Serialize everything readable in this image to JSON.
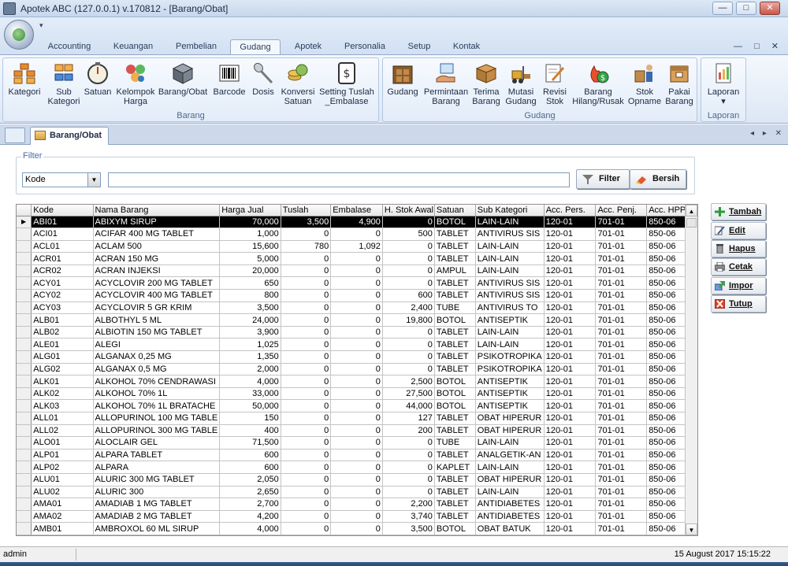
{
  "window": {
    "title": "Apotek ABC (127.0.0.1) v.170812 - [Barang/Obat]",
    "controls": [
      "—",
      "□",
      "✕"
    ]
  },
  "ribbon": {
    "tabs": [
      "Accounting",
      "Keuangan",
      "Pembelian",
      "Gudang",
      "Apotek",
      "Personalia",
      "Setup",
      "Kontak"
    ],
    "active_tab": "Gudang",
    "right_controls": "— □ ✕",
    "groups": {
      "barang": {
        "label": "Barang",
        "buttons": [
          "Kategori",
          "Sub\nKategori",
          "Satuan",
          "Kelompok\nHarga",
          "Barang/Obat",
          "Barcode",
          "Dosis",
          "Konversi\nSatuan",
          "Setting Tuslah\n_Embalase"
        ]
      },
      "gudang": {
        "label": "Gudang",
        "buttons": [
          "Gudang",
          "Permintaan\nBarang",
          "Terima\nBarang",
          "Mutasi\nGudang",
          "Revisi\nStok",
          "Barang\nHilang/Rusak",
          "Stok\nOpname",
          "Pakai\nBarang"
        ]
      },
      "laporan": {
        "label": "Laporan",
        "buttons": [
          "Laporan\n▾"
        ]
      }
    }
  },
  "doc_tab": {
    "label": "Barang/Obat",
    "nav": "◂ ▸ ✕"
  },
  "filter": {
    "legend": "Filter",
    "field": "Kode",
    "value": "",
    "filter_button": "Filter",
    "clear_button": "Bersih"
  },
  "grid": {
    "columns": [
      "Kode",
      "Nama Barang",
      "Harga Jual",
      "Tuslah",
      "Embalase",
      "H. Stok Awal",
      "Satuan",
      "Sub Kategori",
      "Acc. Pers.",
      "Acc. Penj.",
      "Acc. HPP"
    ],
    "rows": [
      [
        "ABI01",
        "ABIXYM SIRUP",
        "70,000",
        "3,500",
        "4,900",
        "0",
        "BOTOL",
        "LAIN-LAIN",
        "120-01",
        "701-01",
        "850-06"
      ],
      [
        "ACI01",
        "ACIFAR 400 MG TABLET",
        "1,000",
        "0",
        "0",
        "500",
        "TABLET",
        "ANTIVIRUS SIS",
        "120-01",
        "701-01",
        "850-06"
      ],
      [
        "ACL01",
        "ACLAM 500",
        "15,600",
        "780",
        "1,092",
        "0",
        "TABLET",
        "LAIN-LAIN",
        "120-01",
        "701-01",
        "850-06"
      ],
      [
        "ACR01",
        "ACRAN 150 MG",
        "5,000",
        "0",
        "0",
        "0",
        "TABLET",
        "LAIN-LAIN",
        "120-01",
        "701-01",
        "850-06"
      ],
      [
        "ACR02",
        "ACRAN INJEKSI",
        "20,000",
        "0",
        "0",
        "0",
        "AMPUL",
        "LAIN-LAIN",
        "120-01",
        "701-01",
        "850-06"
      ],
      [
        "ACY01",
        "ACYCLOVIR 200 MG TABLET",
        "650",
        "0",
        "0",
        "0",
        "TABLET",
        "ANTIVIRUS SIS",
        "120-01",
        "701-01",
        "850-06"
      ],
      [
        "ACY02",
        "ACYCLOVIR 400 MG TABLET",
        "800",
        "0",
        "0",
        "600",
        "TABLET",
        "ANTIVIRUS SIS",
        "120-01",
        "701-01",
        "850-06"
      ],
      [
        "ACY03",
        "ACYCLOVIR 5 GR KRIM",
        "3,500",
        "0",
        "0",
        "2,400",
        "TUBE",
        "ANTIVIRUS TO",
        "120-01",
        "701-01",
        "850-06"
      ],
      [
        "ALB01",
        "ALBOTHYL 5 ML",
        "24,000",
        "0",
        "0",
        "19,800",
        "BOTOL",
        "ANTISEPTIK",
        "120-01",
        "701-01",
        "850-06"
      ],
      [
        "ALB02",
        "ALBIOTIN 150 MG TABLET",
        "3,900",
        "0",
        "0",
        "0",
        "TABLET",
        "LAIN-LAIN",
        "120-01",
        "701-01",
        "850-06"
      ],
      [
        "ALE01",
        "ALEGI",
        "1,025",
        "0",
        "0",
        "0",
        "TABLET",
        "LAIN-LAIN",
        "120-01",
        "701-01",
        "850-06"
      ],
      [
        "ALG01",
        "ALGANAX 0,25 MG",
        "1,350",
        "0",
        "0",
        "0",
        "TABLET",
        "PSIKOTROPIKA",
        "120-01",
        "701-01",
        "850-06"
      ],
      [
        "ALG02",
        "ALGANAX 0,5 MG",
        "2,000",
        "0",
        "0",
        "0",
        "TABLET",
        "PSIKOTROPIKA",
        "120-01",
        "701-01",
        "850-06"
      ],
      [
        "ALK01",
        "ALKOHOL 70% CENDRAWASI",
        "4,000",
        "0",
        "0",
        "2,500",
        "BOTOL",
        "ANTISEPTIK",
        "120-01",
        "701-01",
        "850-06"
      ],
      [
        "ALK02",
        "ALKOHOL 70% 1L",
        "33,000",
        "0",
        "0",
        "27,500",
        "BOTOL",
        "ANTISEPTIK",
        "120-01",
        "701-01",
        "850-06"
      ],
      [
        "ALK03",
        "ALKOHOL 70% 1L BRATACHE",
        "50,000",
        "0",
        "0",
        "44,000",
        "BOTOL",
        "ANTISEPTIK",
        "120-01",
        "701-01",
        "850-06"
      ],
      [
        "ALL01",
        "ALLOPURINOL 100 MG TABLE",
        "150",
        "0",
        "0",
        "127",
        "TABLET",
        "OBAT HIPERUR",
        "120-01",
        "701-01",
        "850-06"
      ],
      [
        "ALL02",
        "ALLOPURINOL 300 MG TABLE",
        "400",
        "0",
        "0",
        "200",
        "TABLET",
        "OBAT HIPERUR",
        "120-01",
        "701-01",
        "850-06"
      ],
      [
        "ALO01",
        "ALOCLAIR GEL",
        "71,500",
        "0",
        "0",
        "0",
        "TUBE",
        "LAIN-LAIN",
        "120-01",
        "701-01",
        "850-06"
      ],
      [
        "ALP01",
        "ALPARA TABLET",
        "600",
        "0",
        "0",
        "0",
        "TABLET",
        "ANALGETIK-AN",
        "120-01",
        "701-01",
        "850-06"
      ],
      [
        "ALP02",
        "ALPARA",
        "600",
        "0",
        "0",
        "0",
        "KAPLET",
        "LAIN-LAIN",
        "120-01",
        "701-01",
        "850-06"
      ],
      [
        "ALU01",
        "ALURIC 300 MG TABLET",
        "2,050",
        "0",
        "0",
        "0",
        "TABLET",
        "OBAT HIPERUR",
        "120-01",
        "701-01",
        "850-06"
      ],
      [
        "ALU02",
        "ALURIC 300",
        "2,650",
        "0",
        "0",
        "0",
        "TABLET",
        "LAIN-LAIN",
        "120-01",
        "701-01",
        "850-06"
      ],
      [
        "AMA01",
        "AMADIAB 1 MG TABLET",
        "2,700",
        "0",
        "0",
        "2,200",
        "TABLET",
        "ANTIDIABETES",
        "120-01",
        "701-01",
        "850-06"
      ],
      [
        "AMA02",
        "AMADIAB 2 MG TABLET",
        "4,200",
        "0",
        "0",
        "3,740",
        "TABLET",
        "ANTIDIABETES",
        "120-01",
        "701-01",
        "850-06"
      ],
      [
        "AMB01",
        "AMBROXOL 60 ML SIRUP",
        "4,000",
        "0",
        "0",
        "3,500",
        "BOTOL",
        "OBAT BATUK",
        "120-01",
        "701-01",
        "850-06"
      ]
    ]
  },
  "side_buttons": [
    "Tambah",
    "Edit",
    "Hapus",
    "Cetak",
    "Impor",
    "Tutup"
  ],
  "status": {
    "user": "admin",
    "datetime": "15 August 2017   15:15:22"
  },
  "colors": {
    "ribbon_bg": "#dce7f5",
    "selected_row": "#000000",
    "group_label": "#50688d"
  }
}
